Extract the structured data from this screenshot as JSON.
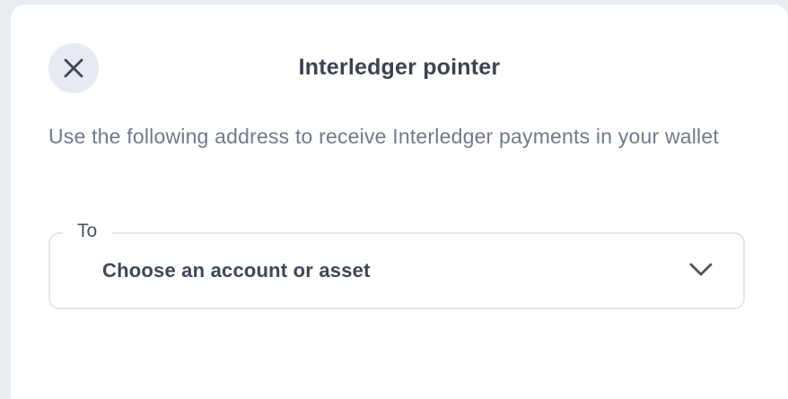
{
  "dialog": {
    "title": "Interledger pointer",
    "close_icon": "close-icon",
    "description": "Use the following address to receive Interledger payments in your wallet"
  },
  "destination_select": {
    "label": "To",
    "selected_value": "Choose an account or asset",
    "dropdown_icon": "chevron-down-icon"
  },
  "colors": {
    "background": "#e9edf2",
    "panel": "#ffffff",
    "title_text": "#3b4351",
    "body_text": "#717a89",
    "close_button_bg": "#e6ebf1",
    "field_border": "#e2e7ec"
  }
}
